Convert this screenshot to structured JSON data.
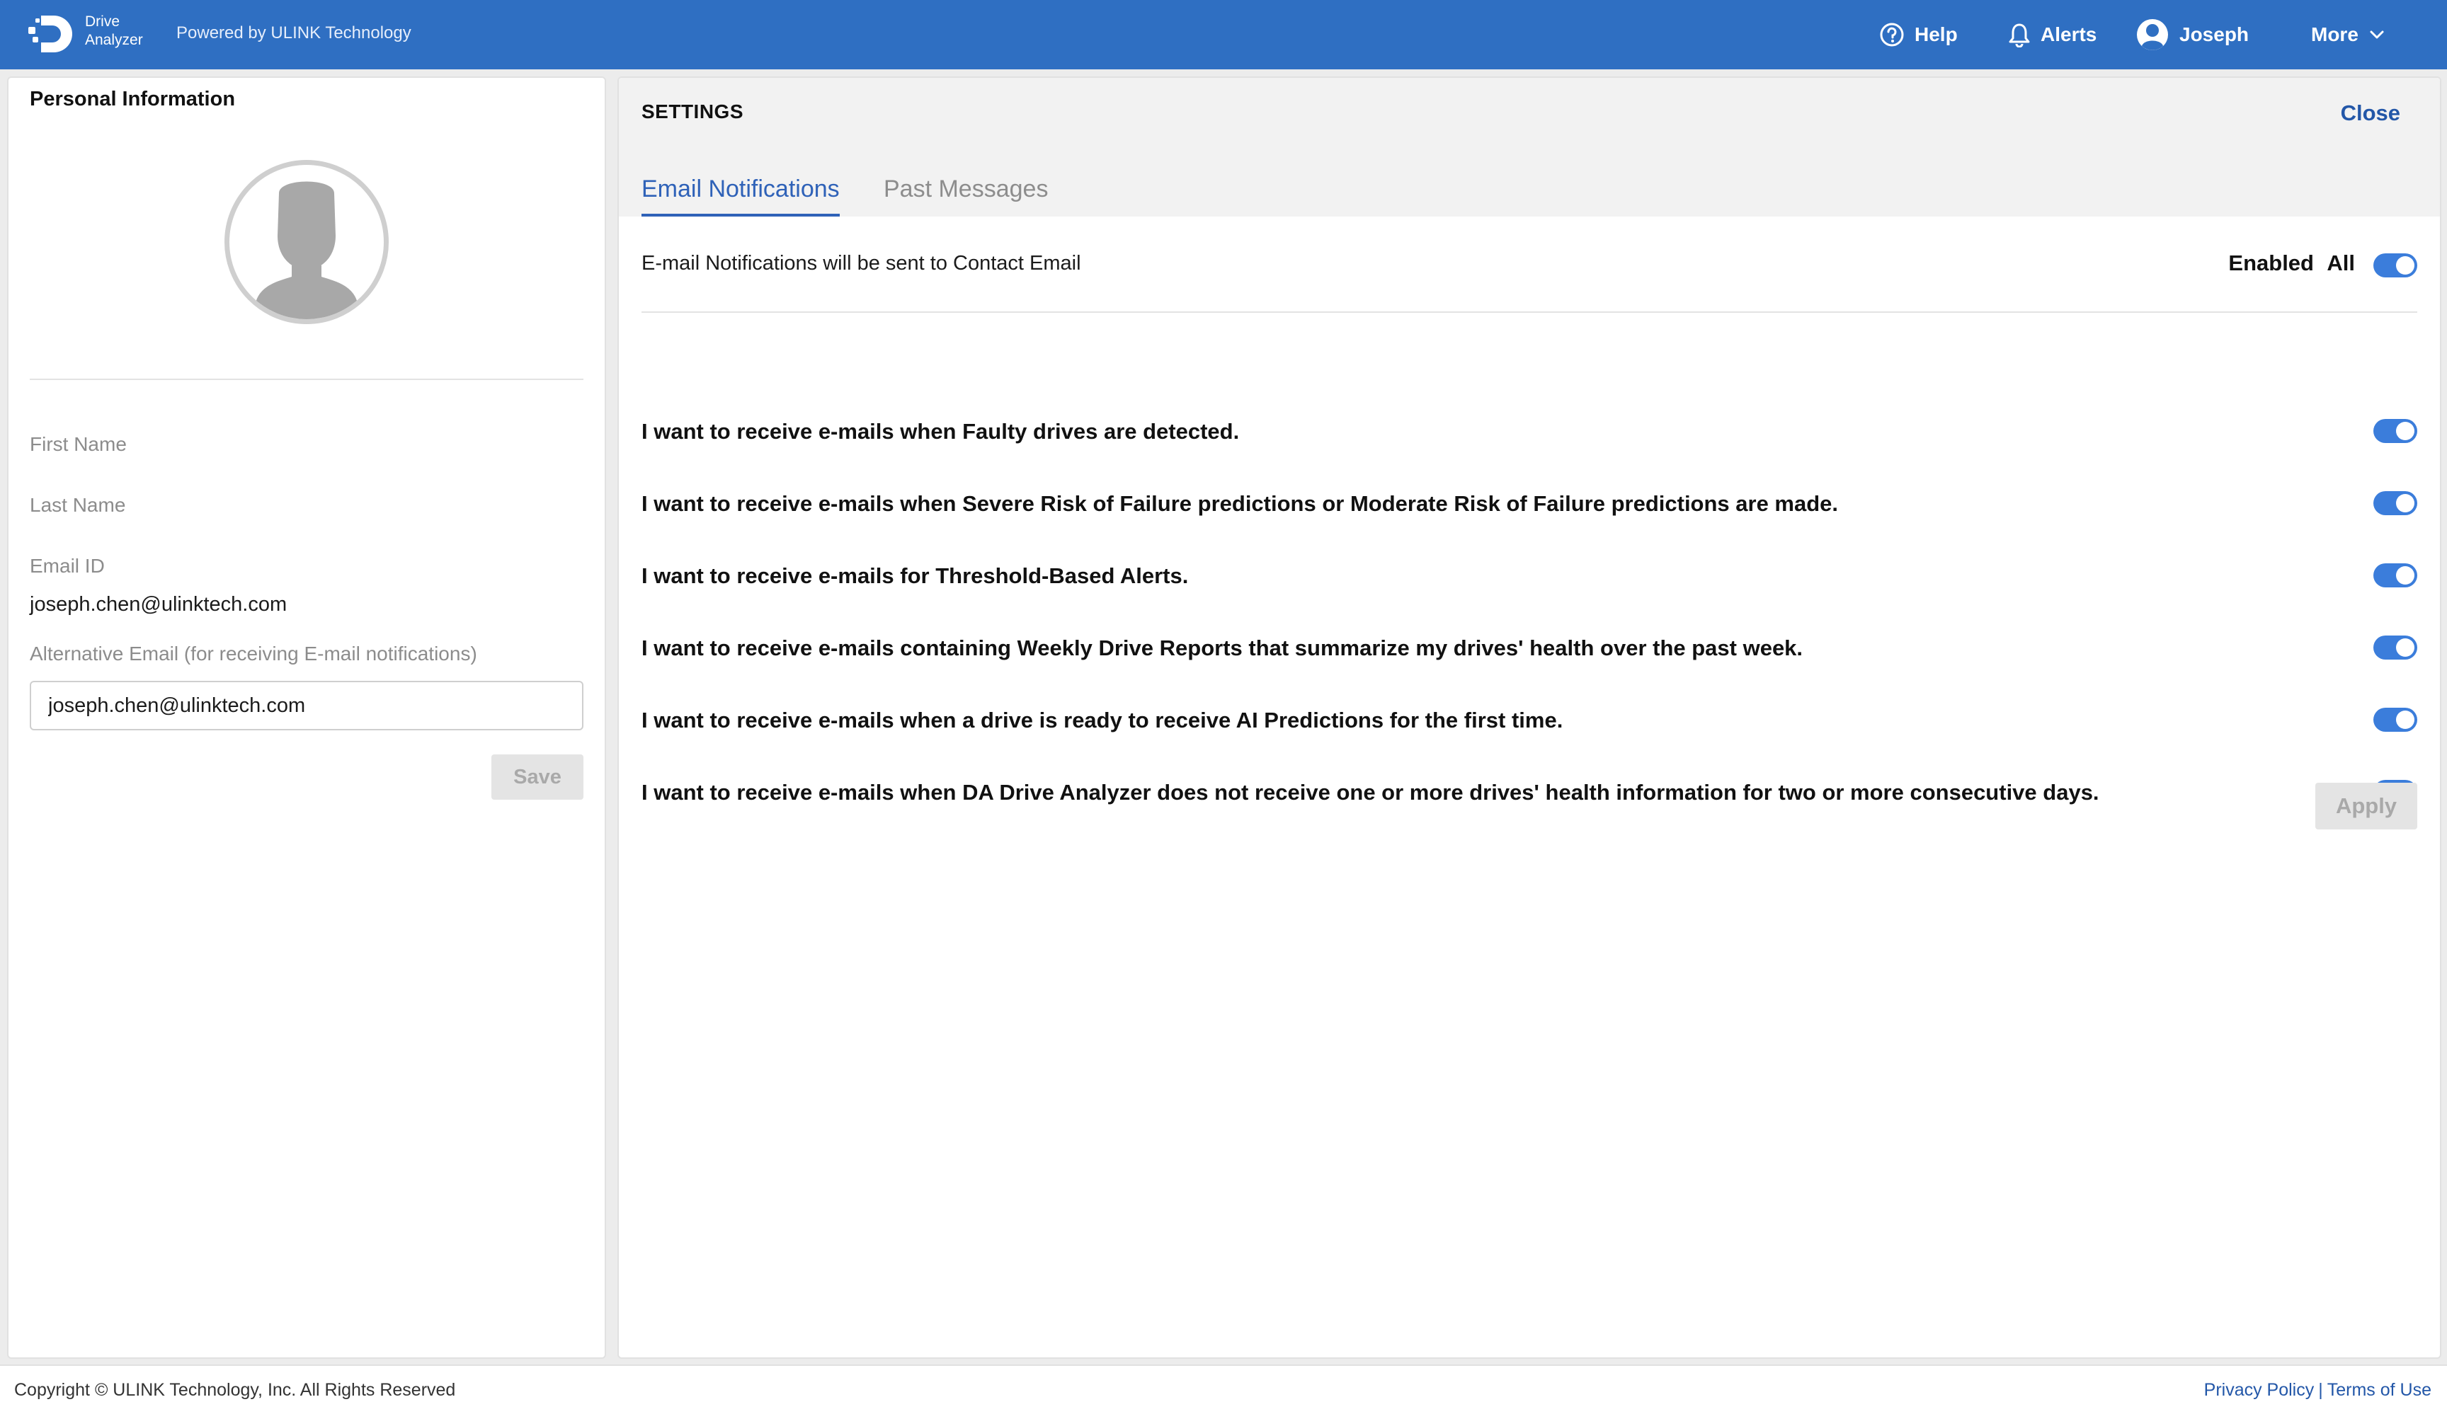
{
  "header": {
    "brand_line1": "Drive",
    "brand_line2": "Analyzer",
    "powered_by": "Powered by ULINK Technology",
    "help": "Help",
    "alerts": "Alerts",
    "user": "Joseph",
    "more": "More",
    "colors": {
      "bar": "#2f6fc2",
      "text": "#ffffff"
    }
  },
  "personal": {
    "title": "Personal Information",
    "first_name_label": "First Name",
    "last_name_label": "Last Name",
    "email_id_label": "Email ID",
    "email_id_value": "joseph.chen@ulinktech.com",
    "alt_email_label": "Alternative Email (for receiving E-mail notifications)",
    "alt_email_value": "joseph.chen@ulinktech.com",
    "save_label": "Save"
  },
  "settings": {
    "title": "SETTINGS",
    "close_label": "Close",
    "tabs": [
      {
        "label": "Email Notifications",
        "active": true
      },
      {
        "label": "Past Messages",
        "active": false
      }
    ],
    "master_text": "E-mail Notifications will be sent to Contact Email",
    "enabled_label": "Enabled",
    "all_label": "All",
    "master_enabled": true,
    "preferences": [
      {
        "text": "I want to receive e-mails when Faulty drives are detected.",
        "enabled": true
      },
      {
        "text": "I want to receive e-mails when Severe Risk of Failure predictions or Moderate Risk of Failure predictions are made.",
        "enabled": true
      },
      {
        "text": "I want to receive e-mails for Threshold-Based Alerts.",
        "enabled": true
      },
      {
        "text": "I want to receive e-mails containing Weekly Drive Reports that summarize my drives' health over the past week.",
        "enabled": true
      },
      {
        "text": "I want to receive e-mails when a drive is ready to receive AI Predictions for the first time.",
        "enabled": true
      },
      {
        "text": "I want to receive e-mails when DA Drive Analyzer does not receive one or more drives' health information for two or more consecutive days.",
        "enabled": true
      }
    ],
    "apply_label": "Apply",
    "colors": {
      "accent": "#2f62b8",
      "toggle_on": "#3b7ddb"
    }
  },
  "footer": {
    "copyright": "Copyright © ULINK Technology, Inc. All Rights Reserved",
    "privacy": "Privacy Policy",
    "separator": "|",
    "terms": "Terms of Use"
  }
}
